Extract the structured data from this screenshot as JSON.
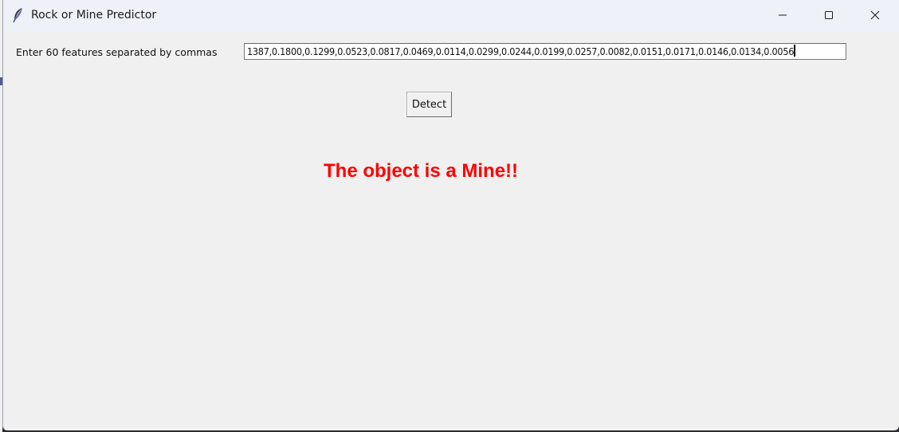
{
  "window": {
    "title": "Rock or Mine Predictor",
    "icons": {
      "app": "feather-icon",
      "minimize": "minimize-icon",
      "maximize": "maximize-icon",
      "close": "close-icon"
    }
  },
  "form": {
    "label": "Enter 60 features separated by commas",
    "input_value": "1387,0.1800,0.1299,0.0523,0.0817,0.0469,0.0114,0.0299,0.0244,0.0199,0.0257,0.0082,0.0151,0.0171,0.0146,0.0134,0.0056",
    "detect_label": "Detect"
  },
  "result": {
    "text": "The object is a Mine!!",
    "color": "#ff0000"
  },
  "colors": {
    "titlebar": "#eef1f8",
    "window_bg": "#f0f0f0"
  }
}
